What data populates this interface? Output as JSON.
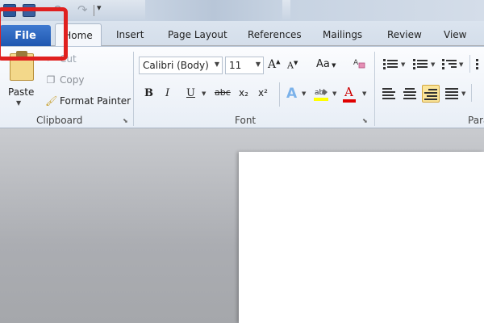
{
  "quick_access": {
    "word_icon": "word-app-icon",
    "save_icon": "save-icon",
    "undo_icon": "undo-icon",
    "redo_icon": "redo-icon",
    "customize_icon": "customize-qat-icon"
  },
  "tabs": {
    "file": "File",
    "home": "Home",
    "insert": "Insert",
    "page_layout": "Page Layout",
    "references": "References",
    "mailings": "Mailings",
    "review": "Review",
    "view": "View"
  },
  "clipboard": {
    "paste": "Paste",
    "cut": "Cut",
    "copy": "Copy",
    "format_painter": "Format Painter",
    "group_label": "Clipboard"
  },
  "font": {
    "name": "Calibri (Body)",
    "size": "11",
    "grow": "A",
    "shrink": "A",
    "change_case": "Aa",
    "bold": "B",
    "italic": "I",
    "underline": "U",
    "strikethrough": "abc",
    "subscript": "x₂",
    "superscript": "x²",
    "text_effects": "A",
    "highlight": "ab",
    "font_color": "A",
    "group_label": "Font"
  },
  "paragraph": {
    "group_label": "Para"
  },
  "colors": {
    "file_tab": "#2b62bd",
    "highlight_box": "#e0201f",
    "font_color_bar": "#e00000",
    "highlight_color_bar": "#ffff00"
  }
}
